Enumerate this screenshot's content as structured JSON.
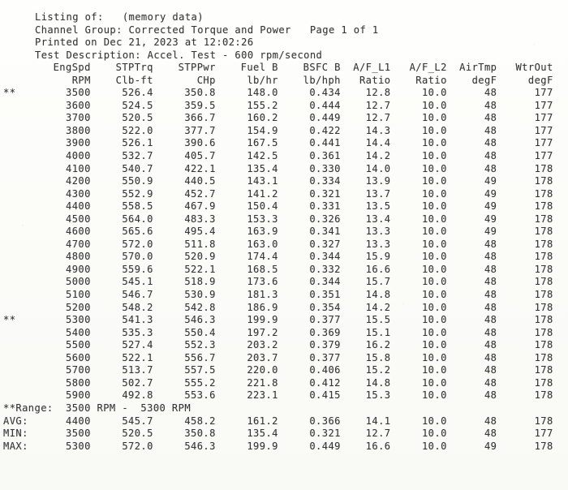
{
  "report": {
    "listing_label": "Listing of:",
    "listing_value": "(memory data)",
    "channel_group_label": "Channel Group:",
    "channel_group_value": "Corrected Torque and Power",
    "page_label": "Page 1 of 1",
    "printed_label": "Printed on",
    "printed_value": "Dec 21, 2023 at 12:02:26",
    "test_description_label": "Test Description:",
    "test_description_value": "Accel. Test - 600 rpm/second"
  },
  "columns": [
    {
      "name": "EngSpd",
      "unit": "RPM"
    },
    {
      "name": "STPTrq",
      "unit": "Clb-ft"
    },
    {
      "name": "STPPwr",
      "unit": "CHp"
    },
    {
      "name": "Fuel B",
      "unit": "lb/hr"
    },
    {
      "name": "BSFC B",
      "unit": "lb/hph"
    },
    {
      "name": "A/F_L1",
      "unit": "Ratio"
    },
    {
      "name": "A/F_L2",
      "unit": "Ratio"
    },
    {
      "name": "AirTmp",
      "unit": "degF"
    },
    {
      "name": "WtrOut",
      "unit": "degF"
    }
  ],
  "marker": "**",
  "rows": [
    {
      "marked": true,
      "EngSpd": "3500",
      "STPTrq": "526.4",
      "STPPwr": "350.8",
      "FuelB": "148.0",
      "BSFCB": "0.434",
      "AF_L1": "12.8",
      "AF_L2": "10.0",
      "AirTmp": "48",
      "WtrOut": "177"
    },
    {
      "marked": false,
      "EngSpd": "3600",
      "STPTrq": "524.5",
      "STPPwr": "359.5",
      "FuelB": "155.2",
      "BSFCB": "0.444",
      "AF_L1": "12.7",
      "AF_L2": "10.0",
      "AirTmp": "48",
      "WtrOut": "177"
    },
    {
      "marked": false,
      "EngSpd": "3700",
      "STPTrq": "520.5",
      "STPPwr": "366.7",
      "FuelB": "160.2",
      "BSFCB": "0.449",
      "AF_L1": "12.7",
      "AF_L2": "10.0",
      "AirTmp": "48",
      "WtrOut": "177"
    },
    {
      "marked": false,
      "EngSpd": "3800",
      "STPTrq": "522.0",
      "STPPwr": "377.7",
      "FuelB": "154.9",
      "BSFCB": "0.422",
      "AF_L1": "14.3",
      "AF_L2": "10.0",
      "AirTmp": "48",
      "WtrOut": "177"
    },
    {
      "marked": false,
      "EngSpd": "3900",
      "STPTrq": "526.1",
      "STPPwr": "390.6",
      "FuelB": "167.5",
      "BSFCB": "0.441",
      "AF_L1": "14.4",
      "AF_L2": "10.0",
      "AirTmp": "48",
      "WtrOut": "177"
    },
    {
      "marked": false,
      "EngSpd": "4000",
      "STPTrq": "532.7",
      "STPPwr": "405.7",
      "FuelB": "142.5",
      "BSFCB": "0.361",
      "AF_L1": "14.2",
      "AF_L2": "10.0",
      "AirTmp": "48",
      "WtrOut": "177"
    },
    {
      "marked": false,
      "EngSpd": "4100",
      "STPTrq": "540.7",
      "STPPwr": "422.1",
      "FuelB": "135.4",
      "BSFCB": "0.330",
      "AF_L1": "14.0",
      "AF_L2": "10.0",
      "AirTmp": "48",
      "WtrOut": "178"
    },
    {
      "marked": false,
      "EngSpd": "4200",
      "STPTrq": "550.9",
      "STPPwr": "440.5",
      "FuelB": "143.1",
      "BSFCB": "0.334",
      "AF_L1": "13.9",
      "AF_L2": "10.0",
      "AirTmp": "49",
      "WtrOut": "178"
    },
    {
      "marked": false,
      "EngSpd": "4300",
      "STPTrq": "552.9",
      "STPPwr": "452.7",
      "FuelB": "141.2",
      "BSFCB": "0.321",
      "AF_L1": "13.7",
      "AF_L2": "10.0",
      "AirTmp": "49",
      "WtrOut": "178"
    },
    {
      "marked": false,
      "EngSpd": "4400",
      "STPTrq": "558.5",
      "STPPwr": "467.9",
      "FuelB": "150.4",
      "BSFCB": "0.331",
      "AF_L1": "13.5",
      "AF_L2": "10.0",
      "AirTmp": "49",
      "WtrOut": "178"
    },
    {
      "marked": false,
      "EngSpd": "4500",
      "STPTrq": "564.0",
      "STPPwr": "483.3",
      "FuelB": "153.3",
      "BSFCB": "0.326",
      "AF_L1": "13.4",
      "AF_L2": "10.0",
      "AirTmp": "49",
      "WtrOut": "178"
    },
    {
      "marked": false,
      "EngSpd": "4600",
      "STPTrq": "565.6",
      "STPPwr": "495.4",
      "FuelB": "163.9",
      "BSFCB": "0.341",
      "AF_L1": "13.3",
      "AF_L2": "10.0",
      "AirTmp": "49",
      "WtrOut": "178"
    },
    {
      "marked": false,
      "EngSpd": "4700",
      "STPTrq": "572.0",
      "STPPwr": "511.8",
      "FuelB": "163.0",
      "BSFCB": "0.327",
      "AF_L1": "13.3",
      "AF_L2": "10.0",
      "AirTmp": "48",
      "WtrOut": "178"
    },
    {
      "marked": false,
      "EngSpd": "4800",
      "STPTrq": "570.0",
      "STPPwr": "520.9",
      "FuelB": "174.4",
      "BSFCB": "0.344",
      "AF_L1": "15.9",
      "AF_L2": "10.0",
      "AirTmp": "48",
      "WtrOut": "178"
    },
    {
      "marked": false,
      "EngSpd": "4900",
      "STPTrq": "559.6",
      "STPPwr": "522.1",
      "FuelB": "168.5",
      "BSFCB": "0.332",
      "AF_L1": "16.6",
      "AF_L2": "10.0",
      "AirTmp": "48",
      "WtrOut": "178"
    },
    {
      "marked": false,
      "EngSpd": "5000",
      "STPTrq": "545.1",
      "STPPwr": "518.9",
      "FuelB": "173.6",
      "BSFCB": "0.344",
      "AF_L1": "15.7",
      "AF_L2": "10.0",
      "AirTmp": "48",
      "WtrOut": "178"
    },
    {
      "marked": false,
      "EngSpd": "5100",
      "STPTrq": "546.7",
      "STPPwr": "530.9",
      "FuelB": "181.3",
      "BSFCB": "0.351",
      "AF_L1": "14.8",
      "AF_L2": "10.0",
      "AirTmp": "48",
      "WtrOut": "178"
    },
    {
      "marked": false,
      "EngSpd": "5200",
      "STPTrq": "548.2",
      "STPPwr": "542.8",
      "FuelB": "186.9",
      "BSFCB": "0.354",
      "AF_L1": "14.2",
      "AF_L2": "10.0",
      "AirTmp": "48",
      "WtrOut": "178"
    },
    {
      "marked": true,
      "EngSpd": "5300",
      "STPTrq": "541.3",
      "STPPwr": "546.3",
      "FuelB": "199.9",
      "BSFCB": "0.377",
      "AF_L1": "15.5",
      "AF_L2": "10.0",
      "AirTmp": "48",
      "WtrOut": "178"
    },
    {
      "marked": false,
      "EngSpd": "5400",
      "STPTrq": "535.3",
      "STPPwr": "550.4",
      "FuelB": "197.2",
      "BSFCB": "0.369",
      "AF_L1": "15.1",
      "AF_L2": "10.0",
      "AirTmp": "48",
      "WtrOut": "178"
    },
    {
      "marked": false,
      "EngSpd": "5500",
      "STPTrq": "527.4",
      "STPPwr": "552.3",
      "FuelB": "203.2",
      "BSFCB": "0.379",
      "AF_L1": "16.2",
      "AF_L2": "10.0",
      "AirTmp": "48",
      "WtrOut": "178"
    },
    {
      "marked": false,
      "EngSpd": "5600",
      "STPTrq": "522.1",
      "STPPwr": "556.7",
      "FuelB": "203.7",
      "BSFCB": "0.377",
      "AF_L1": "15.8",
      "AF_L2": "10.0",
      "AirTmp": "48",
      "WtrOut": "178"
    },
    {
      "marked": false,
      "EngSpd": "5700",
      "STPTrq": "513.7",
      "STPPwr": "557.5",
      "FuelB": "220.0",
      "BSFCB": "0.406",
      "AF_L1": "15.2",
      "AF_L2": "10.0",
      "AirTmp": "48",
      "WtrOut": "178"
    },
    {
      "marked": false,
      "EngSpd": "5800",
      "STPTrq": "502.7",
      "STPPwr": "555.2",
      "FuelB": "221.8",
      "BSFCB": "0.412",
      "AF_L1": "14.8",
      "AF_L2": "10.0",
      "AirTmp": "48",
      "WtrOut": "178"
    },
    {
      "marked": false,
      "EngSpd": "5900",
      "STPTrq": "492.8",
      "STPPwr": "553.6",
      "FuelB": "223.1",
      "BSFCB": "0.415",
      "AF_L1": "15.3",
      "AF_L2": "10.0",
      "AirTmp": "48",
      "WtrOut": "178"
    }
  ],
  "summary": {
    "range_label": "**Range:",
    "range_from": "3500 RPM",
    "range_dash": "-",
    "range_to": "5300 RPM",
    "stats": [
      {
        "label": "AVG:",
        "EngSpd": "4400",
        "STPTrq": "545.7",
        "STPPwr": "458.2",
        "FuelB": "161.2",
        "BSFCB": "0.366",
        "AF_L1": "14.1",
        "AF_L2": "10.0",
        "AirTmp": "48",
        "WtrOut": "178"
      },
      {
        "label": "MIN:",
        "EngSpd": "3500",
        "STPTrq": "520.5",
        "STPPwr": "350.8",
        "FuelB": "135.4",
        "BSFCB": "0.321",
        "AF_L1": "12.7",
        "AF_L2": "10.0",
        "AirTmp": "48",
        "WtrOut": "177"
      },
      {
        "label": "MAX:",
        "EngSpd": "5300",
        "STPTrq": "572.0",
        "STPPwr": "546.3",
        "FuelB": "199.9",
        "BSFCB": "0.449",
        "AF_L1": "16.6",
        "AF_L2": "10.0",
        "AirTmp": "49",
        "WtrOut": "178"
      }
    ]
  }
}
